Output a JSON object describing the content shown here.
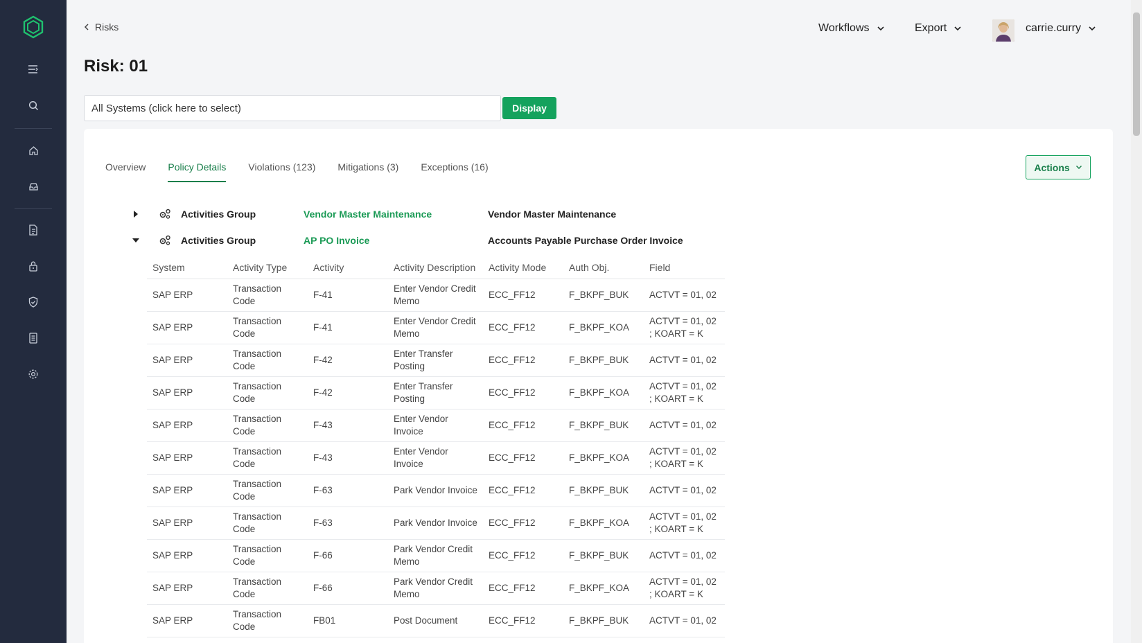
{
  "breadcrumb": {
    "label": "Risks"
  },
  "page": {
    "title": "Risk: 01"
  },
  "topnav": {
    "workflows": "Workflows",
    "export": "Export",
    "user": "carrie.curry"
  },
  "system_select": {
    "value": "All Systems (click here to select)"
  },
  "display_button": "Display",
  "actions_button": "Actions",
  "tabs": [
    {
      "label": "Overview"
    },
    {
      "label": "Policy Details"
    },
    {
      "label": "Violations (123)"
    },
    {
      "label": "Mitigations (3)"
    },
    {
      "label": "Exceptions (16)"
    }
  ],
  "groups": [
    {
      "type": "Activities Group",
      "name": "Vendor Master Maintenance",
      "description": "Vendor Master Maintenance",
      "expanded": false
    },
    {
      "type": "Activities Group",
      "name": "AP PO Invoice",
      "description": "Accounts Payable Purchase Order Invoice",
      "expanded": true
    }
  ],
  "table": {
    "headers": [
      "System",
      "Activity Type",
      "Activity",
      "Activity Description",
      "Activity Mode",
      "Auth Obj.",
      "Field"
    ],
    "rows": [
      [
        "SAP ERP",
        "Transaction Code",
        "F-41",
        "Enter Vendor Credit Memo",
        "ECC_FF12",
        "F_BKPF_BUK",
        "ACTVT = 01, 02"
      ],
      [
        "SAP ERP",
        "Transaction Code",
        "F-41",
        "Enter Vendor Credit Memo",
        "ECC_FF12",
        "F_BKPF_KOA",
        "ACTVT = 01, 02 ; KOART = K"
      ],
      [
        "SAP ERP",
        "Transaction Code",
        "F-42",
        "Enter Transfer Posting",
        "ECC_FF12",
        "F_BKPF_BUK",
        "ACTVT = 01, 02"
      ],
      [
        "SAP ERP",
        "Transaction Code",
        "F-42",
        "Enter Transfer Posting",
        "ECC_FF12",
        "F_BKPF_KOA",
        "ACTVT = 01, 02 ; KOART = K"
      ],
      [
        "SAP ERP",
        "Transaction Code",
        "F-43",
        "Enter Vendor Invoice",
        "ECC_FF12",
        "F_BKPF_BUK",
        "ACTVT = 01, 02"
      ],
      [
        "SAP ERP",
        "Transaction Code",
        "F-43",
        "Enter Vendor Invoice",
        "ECC_FF12",
        "F_BKPF_KOA",
        "ACTVT = 01, 02 ; KOART = K"
      ],
      [
        "SAP ERP",
        "Transaction Code",
        "F-63",
        "Park Vendor Invoice",
        "ECC_FF12",
        "F_BKPF_BUK",
        "ACTVT = 01, 02"
      ],
      [
        "SAP ERP",
        "Transaction Code",
        "F-63",
        "Park Vendor Invoice",
        "ECC_FF12",
        "F_BKPF_KOA",
        "ACTVT = 01, 02 ; KOART = K"
      ],
      [
        "SAP ERP",
        "Transaction Code",
        "F-66",
        "Park Vendor Credit Memo",
        "ECC_FF12",
        "F_BKPF_BUK",
        "ACTVT = 01, 02"
      ],
      [
        "SAP ERP",
        "Transaction Code",
        "F-66",
        "Park Vendor Credit Memo",
        "ECC_FF12",
        "F_BKPF_KOA",
        "ACTVT = 01, 02 ; KOART = K"
      ],
      [
        "SAP ERP",
        "Transaction Code",
        "FB01",
        "Post Document",
        "ECC_FF12",
        "F_BKPF_BUK",
        "ACTVT = 01, 02"
      ]
    ]
  },
  "sidebar": {
    "icons": [
      "menu-icon",
      "search-icon",
      "home-icon",
      "inbox-icon",
      "document-icon",
      "lock-icon",
      "shield-icon",
      "report-icon",
      "gear-icon"
    ]
  },
  "colors": {
    "sidebar": "#232b3e",
    "accent": "#14a25d",
    "link": "#1a9a55"
  }
}
